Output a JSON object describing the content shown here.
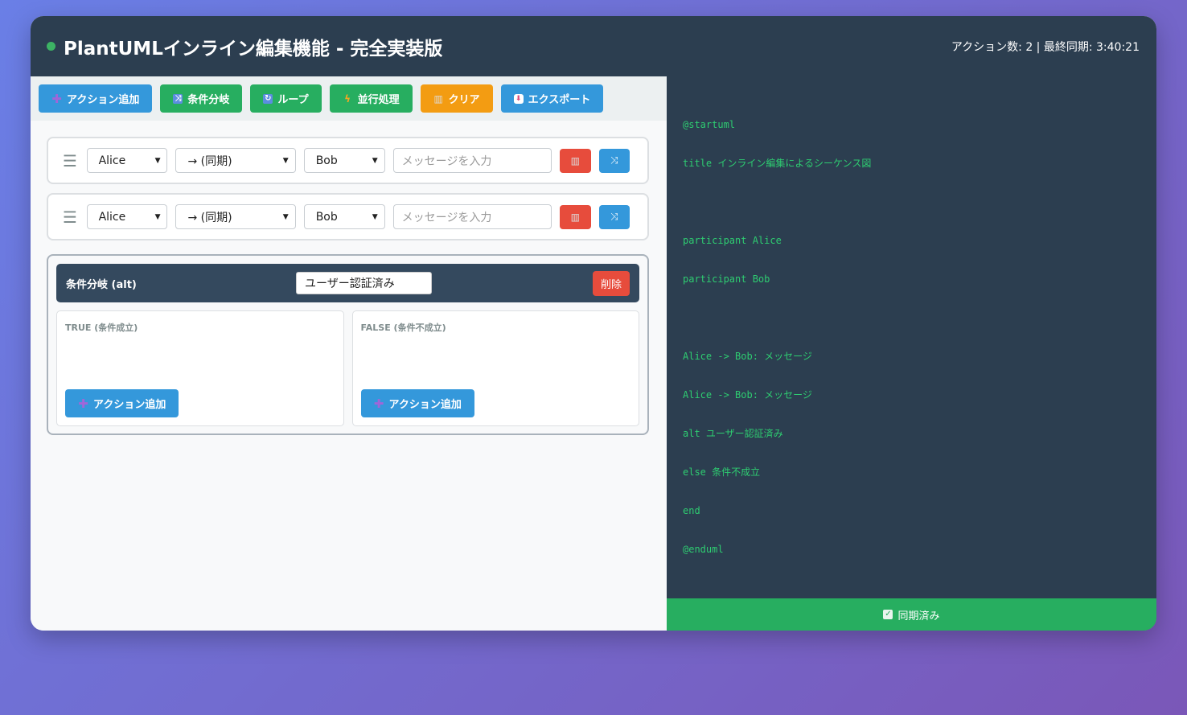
{
  "header": {
    "title": "PlantUMLインライン編集機能 - 完全実装版",
    "status_text": "アクション数: 2 | 最終同期: 3:40:21"
  },
  "toolbar": {
    "buttons": [
      {
        "label": "アクション追加",
        "icon": "plus-icon",
        "color": "#3498db"
      },
      {
        "label": "条件分岐",
        "icon": "shuffle-icon",
        "color": "#27ae60"
      },
      {
        "label": "ループ",
        "icon": "repeat-icon",
        "color": "#27ae60"
      },
      {
        "label": "並行処理",
        "icon": "lightning-icon",
        "color": "#27ae60"
      },
      {
        "label": "クリア",
        "icon": "trash-icon",
        "color": "#f39c12"
      },
      {
        "label": "エクスポート",
        "icon": "export-icon",
        "color": "#3498db"
      }
    ]
  },
  "actions": [
    {
      "from": "Alice",
      "arrow": "→ (同期)",
      "to": "Bob",
      "message_placeholder": "メッセージを入力"
    },
    {
      "from": "Alice",
      "arrow": "→ (同期)",
      "to": "Bob",
      "message_placeholder": "メッセージを入力"
    }
  ],
  "alt_block": {
    "title": "条件分岐 (alt)",
    "condition": "ユーザー認証済み",
    "delete_label": "削除",
    "true_label": "TRUE (条件成立)",
    "false_label": "FALSE (条件不成立)",
    "add_action_label": "アクション追加"
  },
  "code": {
    "lines": [
      "@startuml",
      "title インライン編集によるシーケンス図",
      "",
      "participant Alice",
      "participant Bob",
      "",
      "Alice -> Bob: メッセージ",
      "Alice -> Bob: メッセージ",
      "alt ユーザー認証済み",
      "else 条件不成立",
      "end",
      "@enduml"
    ]
  },
  "sync_status": "同期済み"
}
